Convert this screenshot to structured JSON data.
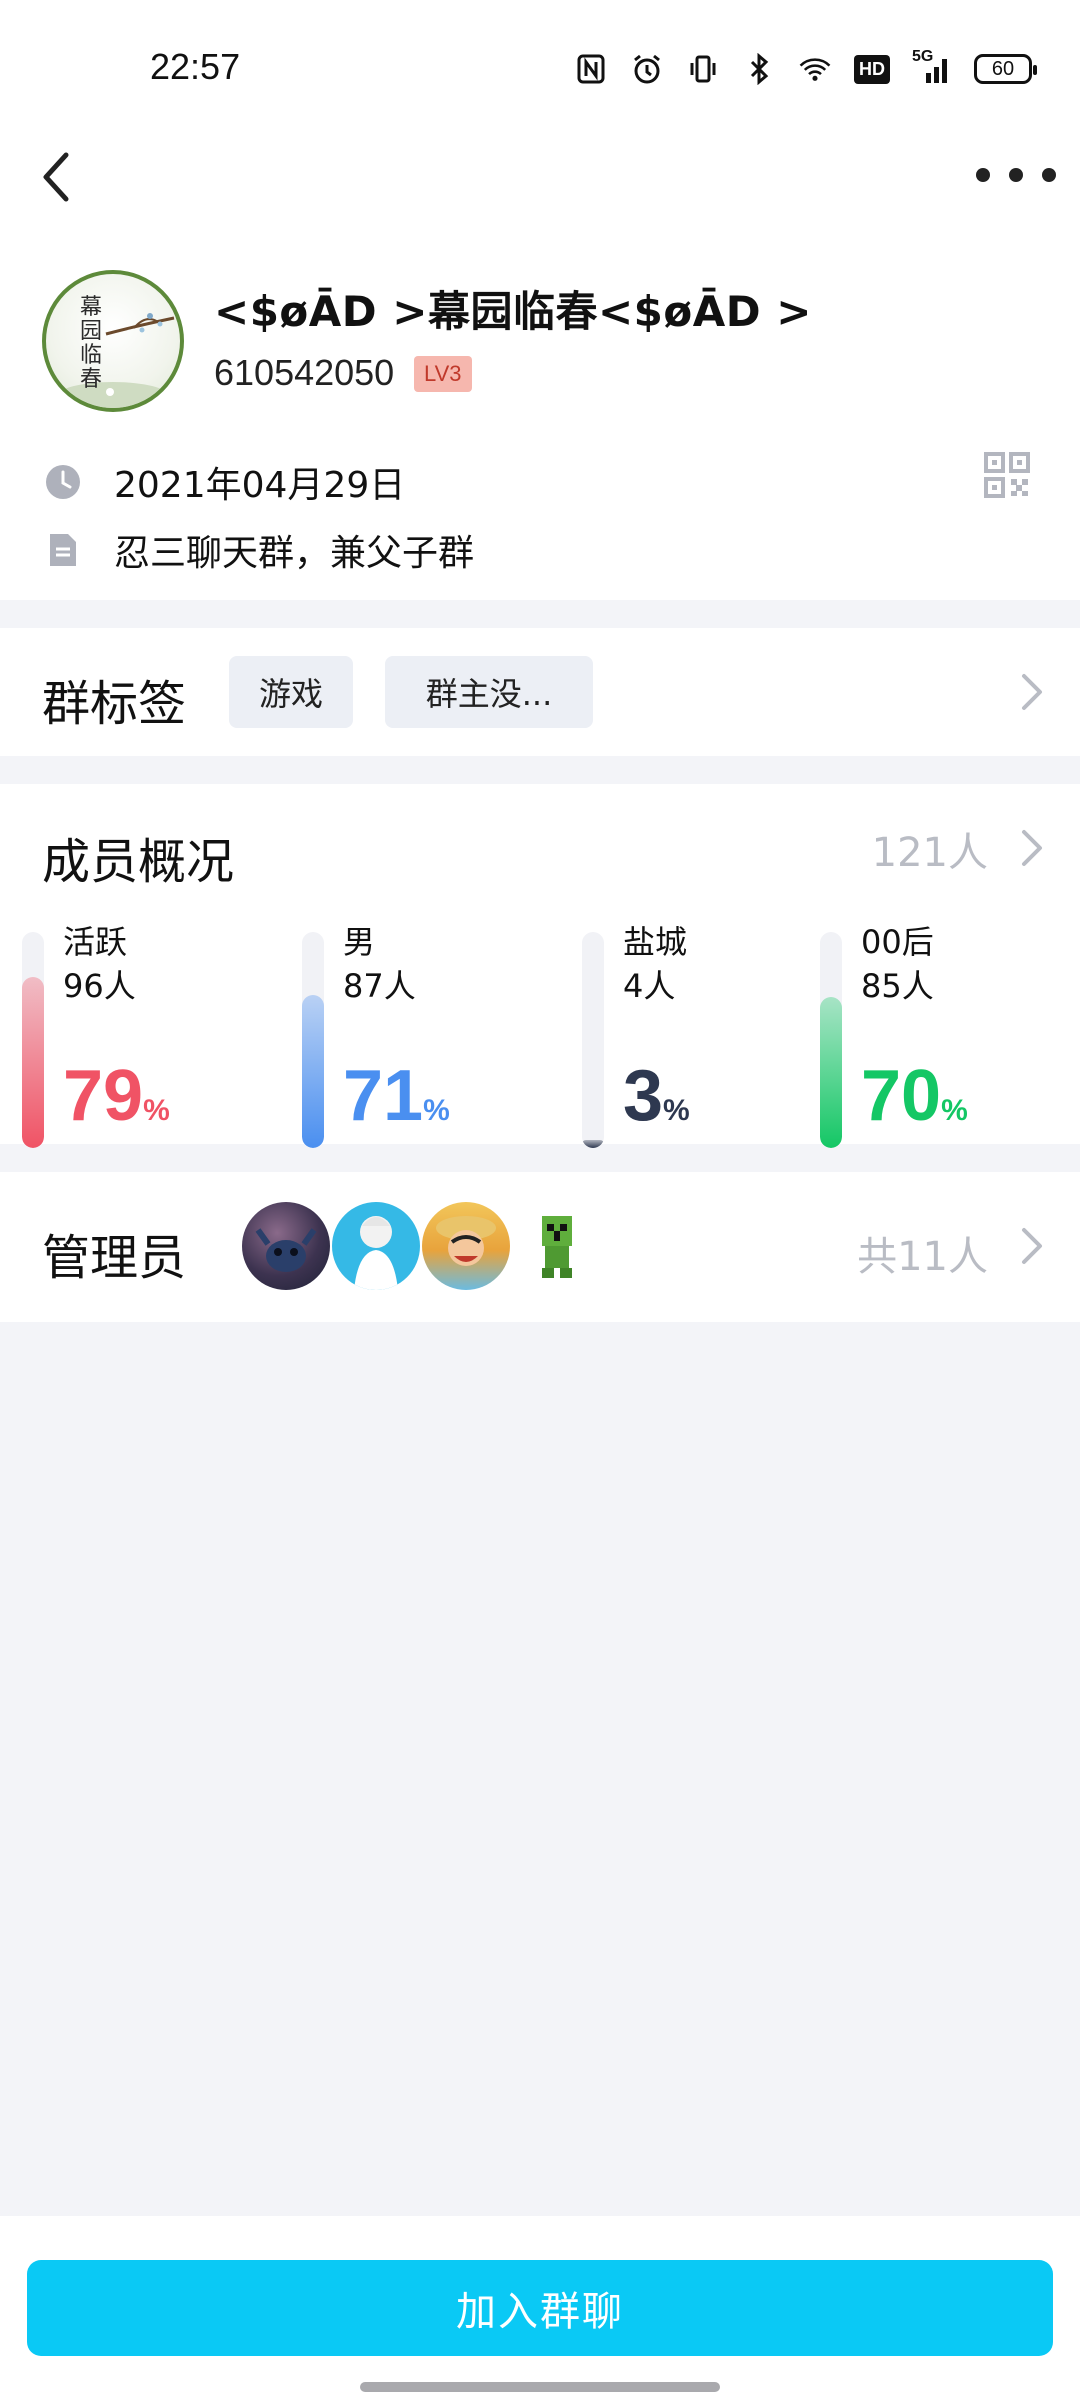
{
  "status_bar": {
    "time": "22:57",
    "battery": "60",
    "hd": "HD",
    "network": "5G",
    "icons": [
      "nfc-icon",
      "alarm-icon",
      "vibrate-icon",
      "bluetooth-icon",
      "wifi-icon",
      "hd-icon",
      "signal-icon",
      "battery-icon"
    ]
  },
  "nav": {
    "back_icon": "chevron-left-icon",
    "more_icon": "more-horizontal-icon"
  },
  "group": {
    "name": "<$øĀD >幕园临春<$øĀD >",
    "id": "610542050",
    "level": "LV3",
    "created_date": "2021年04月29日",
    "description": "忍三聊天群，兼父子群",
    "avatar_text": "幕园临春"
  },
  "tags_section": {
    "title": "群标签",
    "tags": [
      "游戏",
      "群主没..."
    ]
  },
  "members_section": {
    "title": "成员概况",
    "count": "121人",
    "stats": [
      {
        "label": "活跃",
        "count": "96人",
        "percent": "79",
        "sign": "%",
        "fraction": 0.79,
        "color": "#f05365"
      },
      {
        "label": "男",
        "count": "87人",
        "percent": "71",
        "sign": "%",
        "fraction": 0.71,
        "color": "#4a8ff0"
      },
      {
        "label": "盐城",
        "count": "4人",
        "percent": "3",
        "sign": "%",
        "fraction": 0.03,
        "color": "#2e3850"
      },
      {
        "label": "00后",
        "count": "85人",
        "percent": "70",
        "sign": "%",
        "fraction": 0.7,
        "color": "#14c765"
      }
    ]
  },
  "admin_section": {
    "title": "管理员",
    "count": "共11人"
  },
  "footer": {
    "join_label": "加入群聊"
  }
}
